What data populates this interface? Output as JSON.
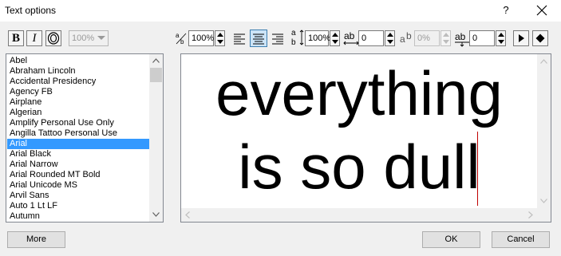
{
  "window": {
    "title": "Text options",
    "help_label": "?"
  },
  "toolbar": {
    "bold_label": "B",
    "italic_label": "I",
    "outline_label": "O",
    "size_select_value": "100%",
    "char_width_value": "100%",
    "line_spacing_value": "100%",
    "char_spacing_value": "0",
    "superscript_value": "0%",
    "baseline_shift_value": "0",
    "alignment_selected": "center"
  },
  "font_list": {
    "items": [
      "Abel",
      "Abraham Lincoln",
      "Accidental Presidency",
      "Agency FB",
      "Airplane",
      "Algerian",
      "Amplify Personal Use Only",
      "Angilla Tattoo Personal Use",
      "Arial",
      "Arial Black",
      "Arial Narrow",
      "Arial Rounded MT Bold",
      "Arial Unicode MS",
      "Arvil Sans",
      "Auto 1 Lt LF",
      "Autumn"
    ],
    "selected": "Arial"
  },
  "preview": {
    "line1": "everything",
    "line2": "is so dull"
  },
  "buttons": {
    "more": "More",
    "ok": "OK",
    "cancel": "Cancel"
  },
  "colors": {
    "selection": "#3399ff",
    "cursor": "#c00000",
    "active_button": "#cce4f7"
  }
}
